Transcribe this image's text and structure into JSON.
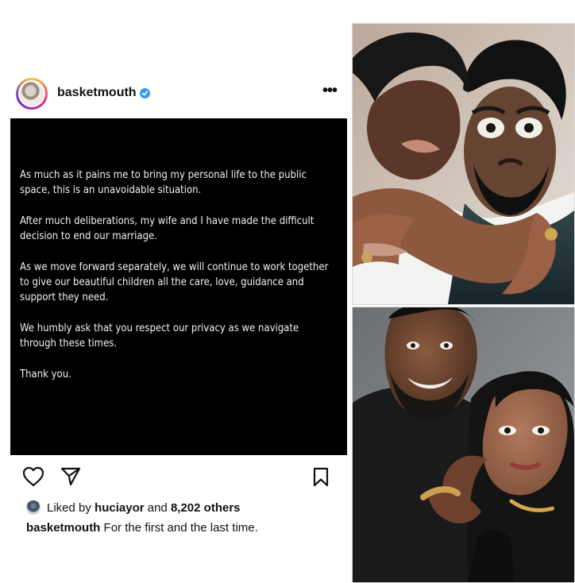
{
  "post": {
    "username": "basketmouth",
    "more_label": "•••",
    "message": [
      "As much as it pains me to bring my personal life to the public space, this is an unavoidable situation.",
      "After much deliberations, my wife and I have made the difficult  decision to end our marriage.",
      "As we move forward separately, we will continue to work together to give our beautiful children all the care, love, guidance and support they need.",
      "We humbly ask that you respect our privacy as we navigate through these times.",
      "Thank you."
    ],
    "likes": {
      "prefix": "Liked by",
      "user": "huciayor",
      "middle": "and",
      "count": "8,202 others"
    },
    "caption": {
      "username": "basketmouth",
      "text": "For the first and the last time."
    },
    "icons": {
      "verified": "verified-badge-icon",
      "heart": "heart-icon",
      "send": "send-icon",
      "save": "bookmark-icon",
      "more": "more-options-icon"
    }
  },
  "colors": {
    "verified": "#3897f0",
    "image_background": "#000000",
    "text_on_image": "#f2f2f2"
  },
  "photos": [
    {
      "description_name": "couple-photo-top"
    },
    {
      "description_name": "couple-photo-bottom"
    }
  ]
}
